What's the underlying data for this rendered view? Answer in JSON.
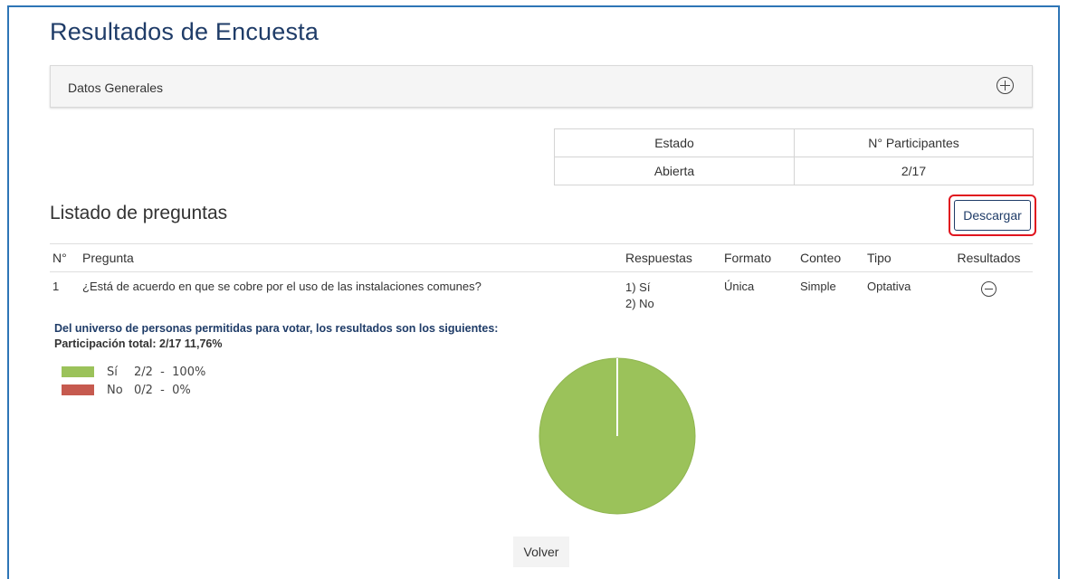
{
  "page": {
    "title": "Resultados de Encuesta"
  },
  "panel": {
    "title": "Datos Generales"
  },
  "status": {
    "headers": [
      "Estado",
      "N° Participantes"
    ],
    "values": [
      "Abierta",
      "2/17"
    ]
  },
  "questions": {
    "title": "Listado de preguntas",
    "download_label": "Descargar",
    "columns": [
      "N°",
      "Pregunta",
      "Respuestas",
      "Formato",
      "Conteo",
      "Tipo",
      "Resultados"
    ],
    "rows": [
      {
        "n": "1",
        "pregunta": "¿Está de acuerdo en que se cobre por el uso de las instalaciones comunes?",
        "respuestas": [
          "1) Sí",
          "2) No"
        ],
        "formato": "Única",
        "conteo": "Simple",
        "tipo": "Optativa"
      }
    ]
  },
  "results": {
    "summary": "Del universo de personas permitidas para votar, los resultados son los siguientes:",
    "participation": "Participación total: 2/17 11,76%"
  },
  "chart_data": {
    "type": "pie",
    "labels": [
      "Sí",
      "No"
    ],
    "counts": [
      "2/2",
      "0/2"
    ],
    "percents": [
      "100%",
      "0%"
    ],
    "values": [
      100,
      0
    ],
    "colors": [
      "#9bc25a",
      "#c65a4f"
    ],
    "legend_position": "top-left"
  },
  "footer": {
    "back_label": "Volver"
  },
  "icons": {
    "expand": "plus-circle-icon",
    "collapse": "minus-circle-icon"
  }
}
